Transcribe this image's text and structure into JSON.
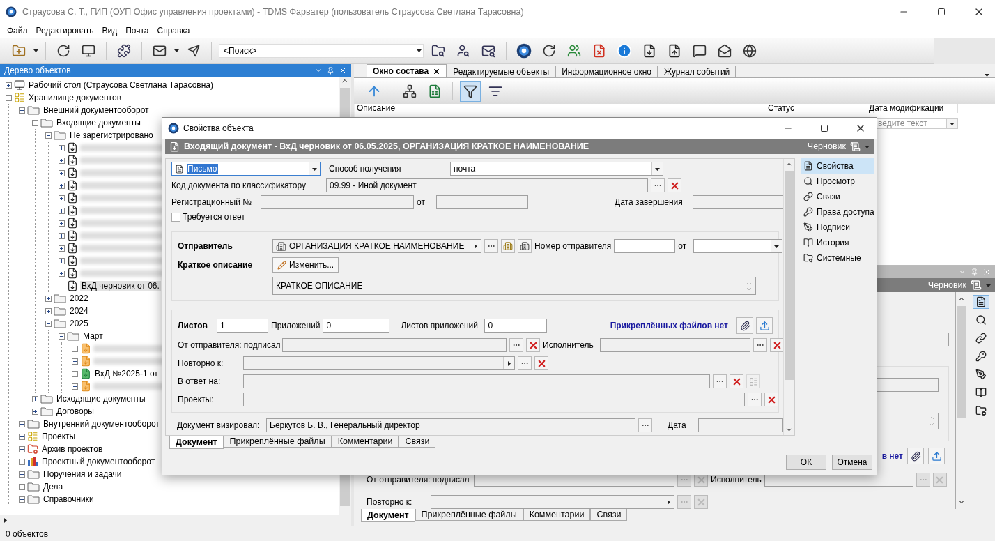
{
  "window": {
    "title": "Страусова С. Т., ГИП (ОУП Офис управления проектами) - TDMS Фарватер (пользователь Страусова Светлана Тарасовна)"
  },
  "menu": [
    "Файл",
    "Редактировать",
    "Вид",
    "Почта",
    "Справка"
  ],
  "toolbar": {
    "search": {
      "value": "<Поиск>"
    }
  },
  "tree_panel": {
    "title": "Дерево объектов",
    "items": [
      {
        "kind": "desktop",
        "label": "Рабочий стол (Страусова Светлана Тарасовна)",
        "expanded": false,
        "selected": false
      },
      {
        "kind": "storage",
        "label": "Хранилище документов",
        "expanded": true,
        "selected": false,
        "children": [
          {
            "kind": "folder",
            "label": "Внешний документооборот",
            "expanded": true,
            "selected": false,
            "children": [
              {
                "kind": "folder",
                "label": "Входящие документы",
                "expanded": true,
                "selected": false,
                "children": [
                  {
                    "kind": "folder",
                    "label": "Не зарегистрировано",
                    "expanded": true,
                    "selected": false,
                    "children": [
                      {
                        "kind": "incoming",
                        "expanded": false,
                        "selected": false
                      },
                      {
                        "kind": "incoming",
                        "expanded": false,
                        "selected": false
                      },
                      {
                        "kind": "incoming",
                        "expanded": false,
                        "selected": false
                      },
                      {
                        "kind": "incoming",
                        "expanded": false,
                        "selected": false
                      },
                      {
                        "kind": "incoming",
                        "expanded": false,
                        "selected": false
                      },
                      {
                        "kind": "incoming",
                        "expanded": false,
                        "selected": false
                      },
                      {
                        "kind": "incoming",
                        "expanded": false,
                        "selected": false
                      },
                      {
                        "kind": "incoming",
                        "expanded": false,
                        "selected": false
                      },
                      {
                        "kind": "incoming",
                        "expanded": false,
                        "selected": false
                      },
                      {
                        "kind": "incoming",
                        "expanded": false,
                        "selected": false
                      },
                      {
                        "kind": "incoming",
                        "expanded": false,
                        "selected": false
                      },
                      {
                        "kind": "incoming",
                        "label": "ВхД черновик от 06.",
                        "selected": true
                      }
                    ]
                  },
                  {
                    "kind": "folder",
                    "label": "2022",
                    "expanded": false,
                    "selected": false
                  },
                  {
                    "kind": "folder",
                    "label": "2024",
                    "expanded": false,
                    "selected": false
                  },
                  {
                    "kind": "folder",
                    "label": "2025",
                    "expanded": true,
                    "selected": false,
                    "children": [
                      {
                        "kind": "folder",
                        "label": "Март",
                        "expanded": true,
                        "selected": false,
                        "children": [
                          {
                            "kind": "incoming-orange",
                            "expanded": false,
                            "selected": false
                          },
                          {
                            "kind": "incoming-orange",
                            "expanded": false,
                            "selected": false
                          },
                          {
                            "kind": "incoming-green",
                            "label": "ВхД №2025-1 от",
                            "expanded": false,
                            "selected": false
                          },
                          {
                            "kind": "incoming-orange",
                            "expanded": false,
                            "selected": false
                          }
                        ]
                      }
                    ]
                  }
                ]
              },
              {
                "kind": "folder",
                "label": "Исходящие документы",
                "expanded": false,
                "selected": false
              },
              {
                "kind": "folder",
                "label": "Договоры",
                "expanded": false,
                "selected": false
              }
            ]
          },
          {
            "kind": "folder",
            "label": "Внутренний документооборот",
            "expanded": false,
            "selected": false
          },
          {
            "kind": "projects",
            "label": "Проекты",
            "expanded": false,
            "selected": false
          },
          {
            "kind": "archive",
            "label": "Архив проектов",
            "expanded": false,
            "selected": false
          },
          {
            "kind": "chart",
            "label": "Проектный документооборот",
            "expanded": false,
            "selected": false
          },
          {
            "kind": "folder",
            "label": "Поручения и задачи",
            "expanded": false,
            "selected": false
          },
          {
            "kind": "folder",
            "label": "Дела",
            "expanded": false,
            "selected": false
          },
          {
            "kind": "folder",
            "label": "Справочники",
            "expanded": false,
            "selected": false
          }
        ]
      }
    ]
  },
  "content_tabs": [
    {
      "label": "Окно состава",
      "selected": true
    },
    {
      "label": "Редактируемые объекты",
      "selected": false
    },
    {
      "label": "Информационное окно",
      "selected": false
    },
    {
      "label": "Журнал событий",
      "selected": false
    }
  ],
  "content_toolbar": {
    "filter_pressed": true
  },
  "table": {
    "columns": [
      "Описание",
      "Статус",
      "Дата модификации"
    ],
    "filter_placeholder": "ведите текст"
  },
  "lower_panel": {
    "status": "Черновик",
    "files_note": "в нет",
    "signed_label": "От отправителя: подписал",
    "executor_label": "Исполнитель",
    "repeat_label": "Повторно к:",
    "tabs": [
      {
        "label": "Документ",
        "selected": true
      },
      {
        "label": "Прикреплённые файлы",
        "selected": false
      },
      {
        "label": "Комментарии",
        "selected": false
      },
      {
        "label": "Связи",
        "selected": false
      }
    ]
  },
  "status_bar": "0 объектов",
  "dialog": {
    "title": "Свойства объекта",
    "header": "Входящий документ - ВхД черновик от 06.05.2025, ОРГАНИЗАЦИЯ КРАТКОЕ НАИМЕНОВАНИЕ",
    "status": "Черновик",
    "doc_type": {
      "value": "Письмо",
      "highlighted": true
    },
    "receive_label": "Способ получения",
    "receive_value": "почта",
    "code_label": "Код документа по классификатору",
    "code_value": "09.99 - Иной документ",
    "reg_label": "Регистрационный  №",
    "reg_from": "от",
    "end_label": "Дата завершения",
    "reply_required": {
      "label": "Требуется ответ",
      "checked": false
    },
    "sender_label": "Отправитель",
    "sender_value": "ОРГАНИЗАЦИЯ КРАТКОЕ НАИМЕНОВАНИЕ",
    "sender_number_label": "Номер отправителя",
    "sender_from": "от",
    "summary_label": "Краткое описание",
    "edit_button": "Изменить...",
    "summary_value": "КРАТКОЕ ОПИСАНИЕ",
    "sheets_label": "Листов",
    "sheets": "1",
    "attachments_label": "Приложений",
    "attachments": "0",
    "attachment_sheets_label": "Листов приложений",
    "attachment_sheets": "0",
    "files_note": "Прикреплённых файлов нет",
    "signed_label": "От отправителя: подписал",
    "executor_label": "Исполнитель",
    "rows": [
      {
        "label": "Повторно к:",
        "arrow": true,
        "link_disabled": false
      },
      {
        "label": "В ответ на:",
        "arrow": false,
        "link_disabled": true
      },
      {
        "label": "Проекты:",
        "arrow": false,
        "link_disabled": false
      }
    ],
    "approved_label": "Документ визировал:",
    "approved_value": "Беркутов Б. В., Генеральный директор",
    "date_label": "Дата",
    "tabs": [
      {
        "label": "Документ",
        "selected": true
      },
      {
        "label": "Прикреплённые файлы",
        "selected": false
      },
      {
        "label": "Комментарии",
        "selected": false
      },
      {
        "label": "Связи",
        "selected": false
      }
    ],
    "nav": [
      {
        "label": "Свойства",
        "selected": true
      },
      {
        "label": "Просмотр",
        "selected": false
      },
      {
        "label": "Связи",
        "selected": false
      },
      {
        "label": "Права доступа",
        "selected": false
      },
      {
        "label": "Подписи",
        "selected": false
      },
      {
        "label": "История",
        "selected": false
      },
      {
        "label": "Системные",
        "selected": false
      }
    ],
    "buttons": [
      "ОК",
      "Отмена"
    ]
  }
}
